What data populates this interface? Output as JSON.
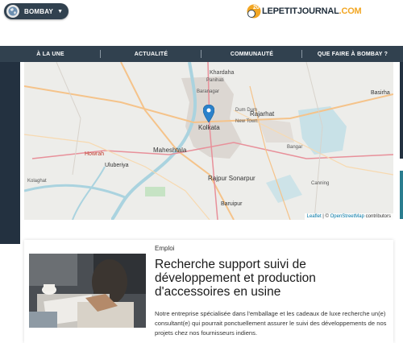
{
  "header": {
    "city": "BOMBAY",
    "logo_number": "20",
    "logo_text": "LEPETITJOURNAL",
    "logo_suffix": ".COM"
  },
  "nav": {
    "items": [
      "À LA UNE",
      "ACTUALITÉ",
      "COMMUNAUTÉ",
      "QUE FAIRE À BOMBAY ?"
    ]
  },
  "map": {
    "places": [
      "Khardaha",
      "Panihati",
      "Dum Dum",
      "Kolkata",
      "Rajarhat",
      "New Town",
      "Maheshtala",
      "Howrah",
      "Uluberiya",
      "Bangar",
      "Rajpur Sonarpur",
      "Baruipur",
      "Basirha",
      "Canning",
      "Kolaghat",
      "Baranagar"
    ],
    "attribution_leaflet": "Leaflet",
    "attribution_sep": " | © ",
    "attribution_osm": "OpenStreetMap",
    "attribution_tail": " contributors"
  },
  "article": {
    "category": "Emploi",
    "title": "Recherche support suivi de développement et production d'accessoires en usine",
    "excerpt": "Notre entreprise spécialisée dans l'emballage et les cadeaux de luxe recherche un(e) consultant(e) qui pourrait ponctuellement assurer le suivi des développements de nos projets chez nos fournisseurs indiens."
  },
  "colors": {
    "navbar": "#31414f",
    "accent": "#f2a623",
    "marker": "#2a81cb"
  }
}
